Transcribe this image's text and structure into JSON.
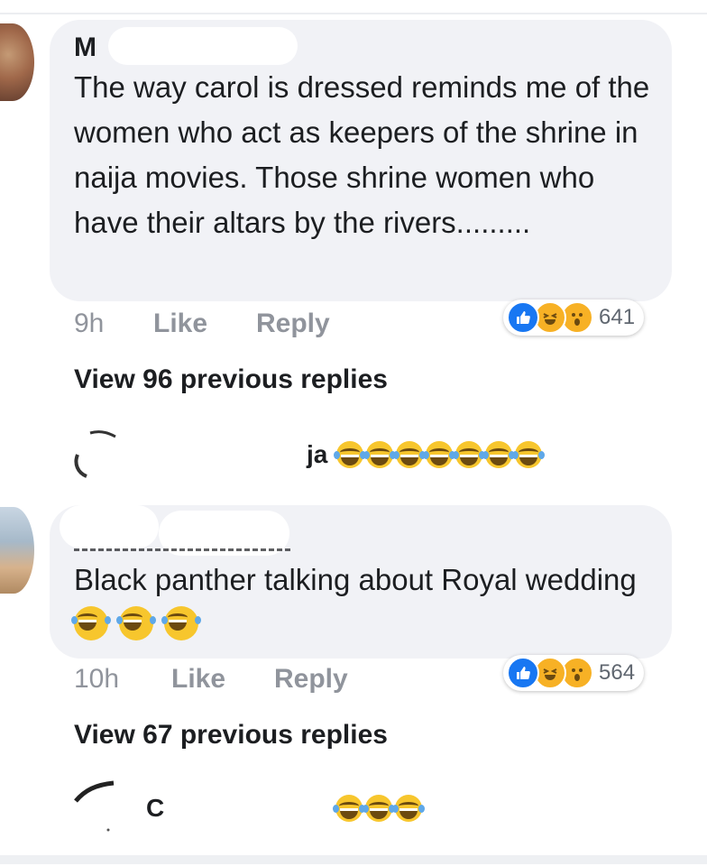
{
  "comments": [
    {
      "author": "M",
      "text": "The way carol is dressed reminds me of the women who act as keepers of the shrine in naija movies. Those shrine women who have their altars by the rivers.........",
      "time": "9h",
      "like_label": "Like",
      "reply_label": "Reply",
      "reaction_icons": [
        "like-icon",
        "haha-icon",
        "wow-icon"
      ],
      "reaction_count": "641",
      "view_previous": "View 96 previous replies",
      "latest_reply": {
        "name": "ja",
        "emoji_count": 7,
        "emoji": "tears-of-joy"
      }
    },
    {
      "author": "",
      "text": "Black panther talking about Royal wedding",
      "text_emoji_count": 3,
      "time": "10h",
      "like_label": "Like",
      "reply_label": "Reply",
      "reaction_icons": [
        "like-icon",
        "haha-icon",
        "wow-icon"
      ],
      "reaction_count": "564",
      "view_previous": "View 67 previous replies",
      "latest_reply": {
        "name": "C",
        "emoji_count": 3,
        "emoji": "tears-of-joy"
      }
    }
  ],
  "colors": {
    "bubble": "#f1f2f6",
    "meta_text": "#90949c",
    "like_blue": "#1877f2",
    "haha_yellow": "#f7b125"
  }
}
